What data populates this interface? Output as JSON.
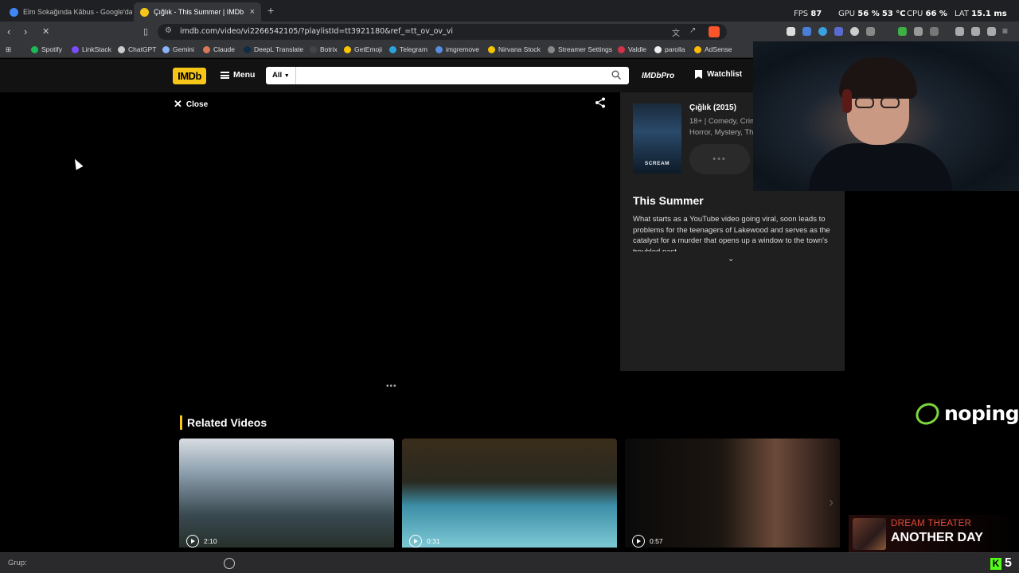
{
  "browser": {
    "tabs": [
      {
        "title": "Elm Sokağında Kâbus - Google'da Ar",
        "active": false
      },
      {
        "title": "Çığlık - This Summer | IMDb",
        "active": true
      }
    ],
    "url": "imdb.com/video/vi2266542105/?playlistId=tt3921180&ref_=tt_ov_ov_vi",
    "bookmarks": [
      "Spotify",
      "LinkStack",
      "ChatGPT",
      "Gemini",
      "Claude",
      "DeepL Translate",
      "Botrix",
      "GetEmoji",
      "Telegram",
      "imgremove",
      "Nirvana Stock",
      "Streamer Settings",
      "Valdle",
      "parolla",
      "AdSense"
    ],
    "stats": {
      "fps_label": "FPS",
      "fps": "87",
      "gpu_label": "GPU",
      "gpu": "56 %",
      "gpu_temp": "53 °C",
      "cpu_label": "CPU",
      "cpu": "66 %",
      "lat_label": "LAT",
      "lat": "15.1 ms"
    }
  },
  "imdb": {
    "logo": "IMDb",
    "menu_label": "Menu",
    "search_category": "All",
    "search_placeholder": "",
    "imdbpro_label": "IMDbPro",
    "watchlist_label": "Watchlist"
  },
  "video": {
    "close_label": "Close",
    "loading_dots": "•••"
  },
  "panel": {
    "poster_text": "SCREAM",
    "movie_title": "Çığlık (2015)",
    "genre_line1": "18+ | Comedy, Crim",
    "genre_line2": "Horror, Mystery, Th",
    "loading_dots": "•••",
    "video_title": "This Summer",
    "description": "What starts as a YouTube video going viral, soon leads to problems for the teenagers of Lakewood and serves as the catalyst for a murder that opens up a window to the town's troubled past.",
    "expand_icon": "chevron-down"
  },
  "related": {
    "heading": "Related Videos",
    "videos": [
      {
        "duration": "2:10"
      },
      {
        "duration": "0:31"
      },
      {
        "duration": "0:57"
      }
    ]
  },
  "overlays": {
    "noping": "noping",
    "music_artist": "DREAM THEATER",
    "music_song": "ANOTHER DAY",
    "kick_count": "5"
  },
  "bottom": {
    "grup_label": "Grup:"
  },
  "colors": {
    "imdb_yellow": "#f5c518",
    "noping_green": "#7ed63a",
    "kick_green": "#53fc18",
    "artist_red": "#e04a3a"
  }
}
